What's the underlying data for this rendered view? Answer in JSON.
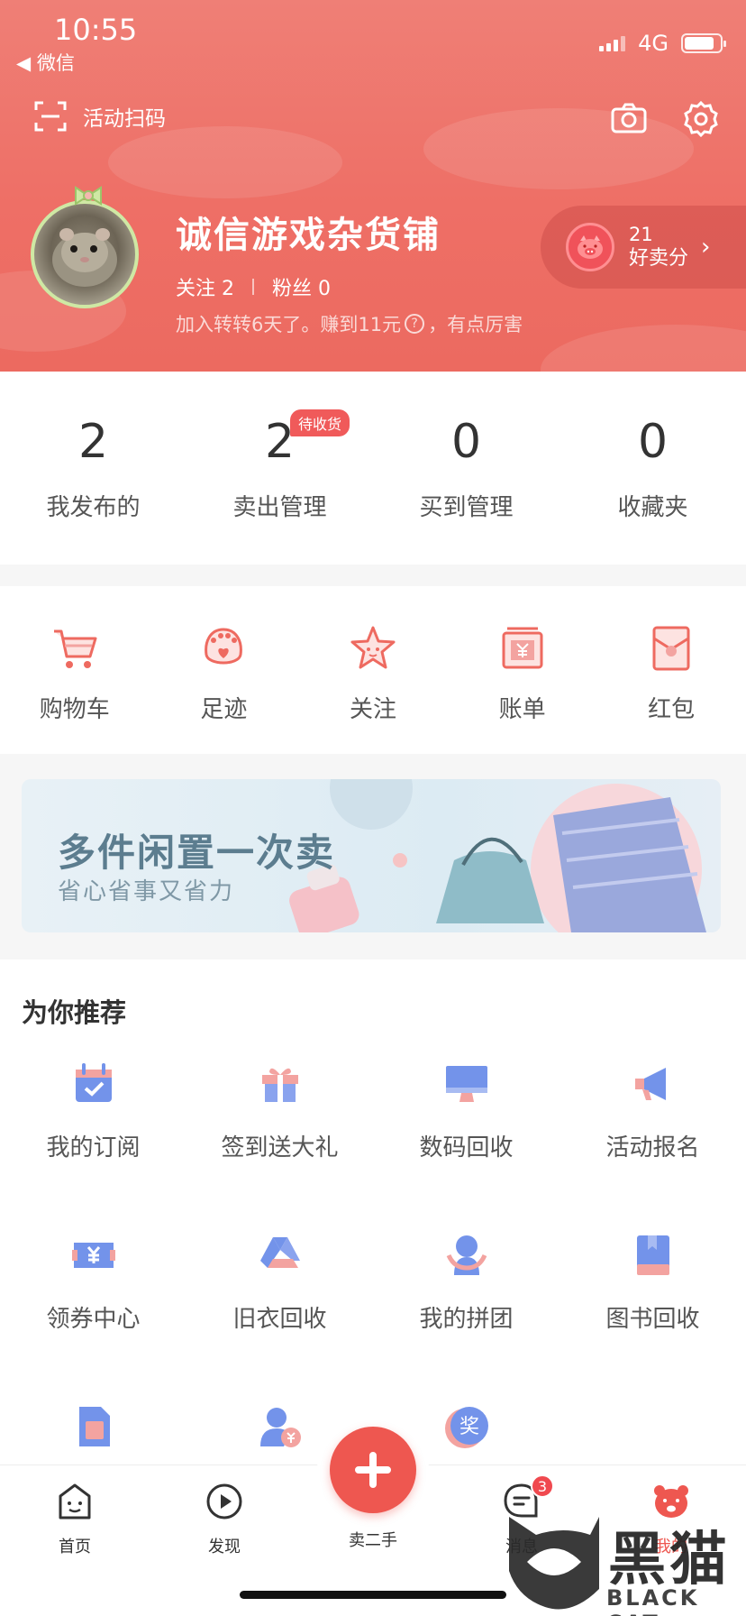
{
  "status_bar": {
    "time": "10:55",
    "back_app": "◀ 微信",
    "network": "4G"
  },
  "header": {
    "scan_label": "活动扫码",
    "shop_name": "诚信游戏杂货铺",
    "following_label": "关注 2",
    "fans_label": "粉丝 0",
    "joined_text": "加入转转6天了。赚到11元",
    "joined_suffix": "，有点厉害",
    "score_value": "21",
    "score_label": "好卖分"
  },
  "stats": [
    {
      "value": "2",
      "label": "我发布的"
    },
    {
      "value": "2",
      "label": "卖出管理",
      "badge": "待收货"
    },
    {
      "value": "0",
      "label": "买到管理"
    },
    {
      "value": "0",
      "label": "收藏夹"
    }
  ],
  "quick_actions": [
    {
      "label": "购物车",
      "icon": "shopping-cart-icon"
    },
    {
      "label": "足迹",
      "icon": "paw-icon"
    },
    {
      "label": "关注",
      "icon": "star-icon"
    },
    {
      "label": "账单",
      "icon": "bill-icon"
    },
    {
      "label": "红包",
      "icon": "red-envelope-icon"
    }
  ],
  "banner": {
    "title": "多件闲置一次卖",
    "subtitle": "省心省事又省力"
  },
  "recommend": {
    "title": "为你推荐",
    "items": [
      {
        "label": "我的订阅",
        "icon": "calendar-check-icon"
      },
      {
        "label": "签到送大礼",
        "icon": "gift-icon"
      },
      {
        "label": "数码回收",
        "icon": "monitor-icon"
      },
      {
        "label": "活动报名",
        "icon": "megaphone-icon"
      },
      {
        "label": "领券中心",
        "icon": "coupon-icon"
      },
      {
        "label": "旧衣回收",
        "icon": "triangle-recycle-icon"
      },
      {
        "label": "我的拼团",
        "icon": "group-person-icon"
      },
      {
        "label": "图书回收",
        "icon": "book-icon"
      },
      {
        "label": "",
        "icon": "sim-card-icon"
      },
      {
        "label": "",
        "icon": "person-money-icon"
      },
      {
        "label": "",
        "icon": "award-icon"
      }
    ]
  },
  "tabbar": {
    "home": "首页",
    "discover": "发现",
    "sell": "卖二手",
    "messages": "消息",
    "messages_badge": "3",
    "mine": "我的"
  },
  "watermark": {
    "text": "黑猫",
    "sub": "BLACK CAT"
  },
  "colors": {
    "brand": "#ee6a60",
    "accent_blue": "#6f8fe8",
    "accent_pink": "#f3a3a0"
  }
}
